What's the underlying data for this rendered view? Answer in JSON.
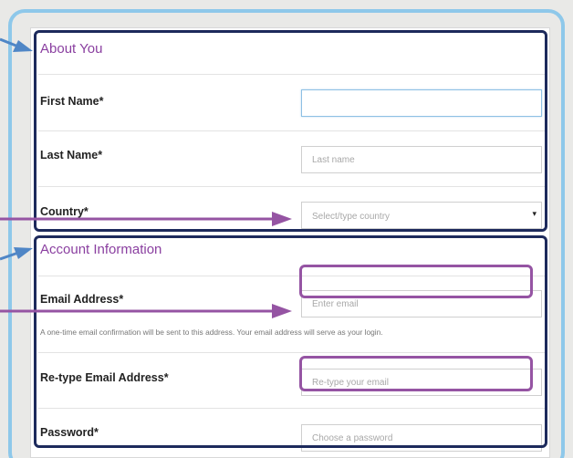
{
  "sections": {
    "about_heading": "About You",
    "account_heading": "Account Information"
  },
  "fields": {
    "first_name": {
      "label": "First Name*",
      "value": "",
      "placeholder": ""
    },
    "last_name": {
      "label": "Last Name*",
      "placeholder": "Last name"
    },
    "country": {
      "label": "Country*",
      "placeholder": "Select/type country"
    },
    "email": {
      "label": "Email Address*",
      "placeholder": "Enter email"
    },
    "email_help": "A one-time email confirmation will be sent to this address. Your email address will serve as your login.",
    "retype_email": {
      "label": "Re-type Email Address*",
      "placeholder": "Re-type your email"
    },
    "password": {
      "label": "Password*",
      "placeholder": "Choose a password"
    }
  },
  "annotation_colors": {
    "navy": "#1d2a5c",
    "purple": "#9554a3",
    "blue": "#4f86c6",
    "frame": "#8ec8ea"
  },
  "icons": {
    "select_caret": "▾"
  }
}
